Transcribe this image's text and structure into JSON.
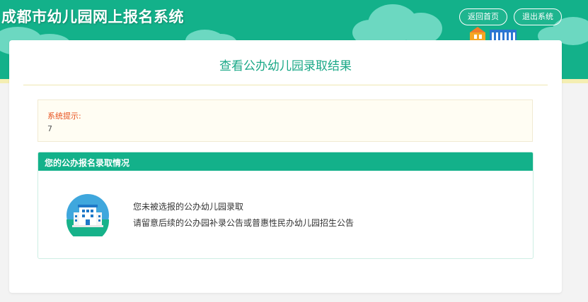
{
  "header": {
    "site_title": "成都市幼儿园网上报名系统",
    "home_button": "返回首页",
    "logout_button": "退出系统"
  },
  "page": {
    "heading": "查看公办幼儿园录取结果"
  },
  "notice": {
    "label": "系统提示:",
    "value": "7"
  },
  "result": {
    "panel_title": "您的公办报名录取情况",
    "message_line1": "您未被选报的公办幼儿园录取",
    "message_line2": "请留意后续的公办园补录公告或普惠性民办幼儿园招生公告"
  },
  "colors": {
    "brand_green": "#13b18a",
    "accent_yellow": "#f4eeb2",
    "warning_red": "#e8531f"
  },
  "icons": {
    "school": "school-building-icon",
    "decoration": "kindergarten-building-icon"
  }
}
